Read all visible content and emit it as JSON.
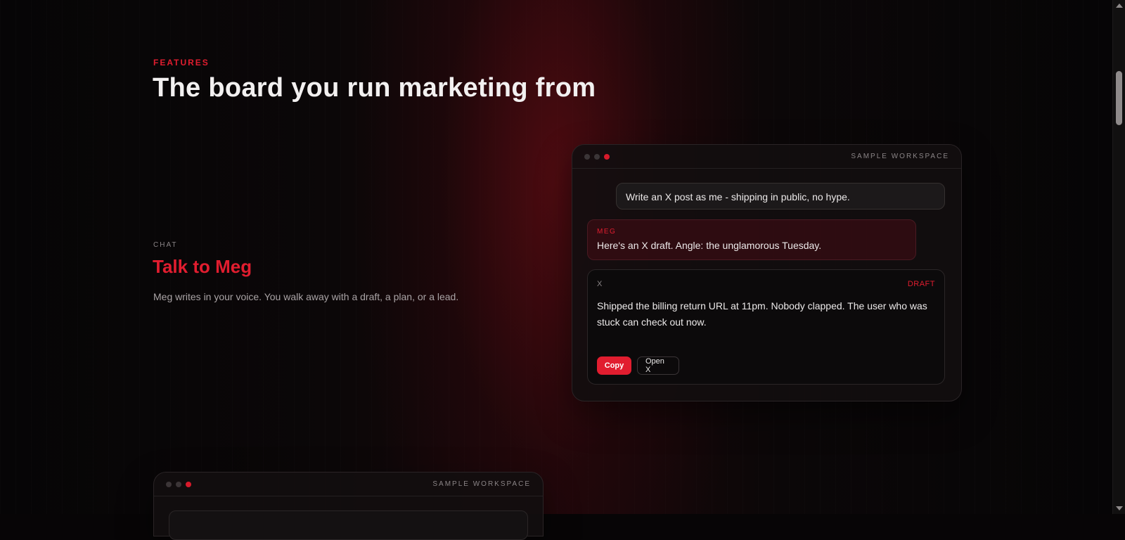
{
  "section": {
    "eyebrow": "FEATURES",
    "headline": "The board you run marketing from"
  },
  "feature": {
    "kicker": "CHAT",
    "title": "Talk to Meg",
    "description": "Meg writes in your voice. You walk away with a draft, a plan, or a lead."
  },
  "window_primary": {
    "label": "SAMPLE WORKSPACE",
    "user_message": "Write an X post as me - shipping in public, no hype.",
    "assistant_name": "MEG",
    "assistant_message": "Here's an X draft. Angle: the unglamorous Tuesday.",
    "draft": {
      "platform": "X",
      "status": "DRAFT",
      "body": "Shipped the billing return URL at 11pm. Nobody clapped. The user who was stuck can check out now.",
      "copy_label": "Copy",
      "open_label": "Open X"
    }
  },
  "window_secondary": {
    "label": "SAMPLE WORKSPACE"
  },
  "colors": {
    "accent": "#e11d2f",
    "background": "#070506",
    "panel": "#120e0f"
  },
  "icons": {
    "scroll_up": "chevron-up-icon",
    "scroll_down": "chevron-down-icon"
  }
}
